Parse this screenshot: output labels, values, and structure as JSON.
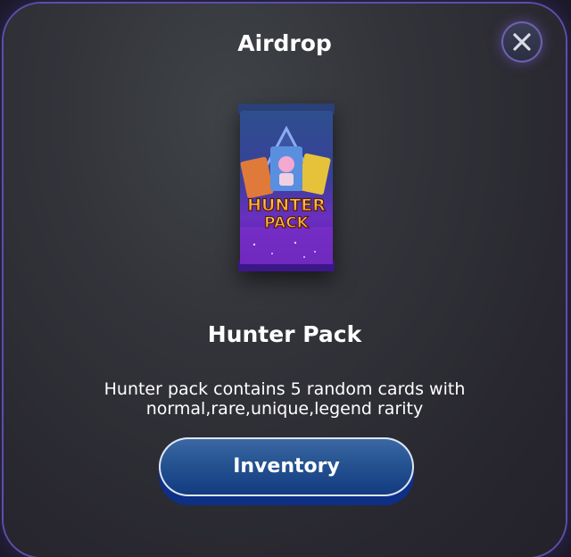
{
  "modal": {
    "title": "Airdrop",
    "close_icon": "close-icon"
  },
  "item": {
    "name": "Hunter Pack",
    "description": "Hunter pack contains 5 random cards with normal,rare,unique,legend rarity",
    "pack_logo_line1": "HUNTER",
    "pack_logo_line2": "PACK"
  },
  "actions": {
    "inventory_label": "Inventory"
  },
  "colors": {
    "button_top": "#3d6aa5",
    "button_bottom": "#123a80",
    "pack_purple": "#7b2fc9",
    "pack_blue": "#3a4db0"
  }
}
